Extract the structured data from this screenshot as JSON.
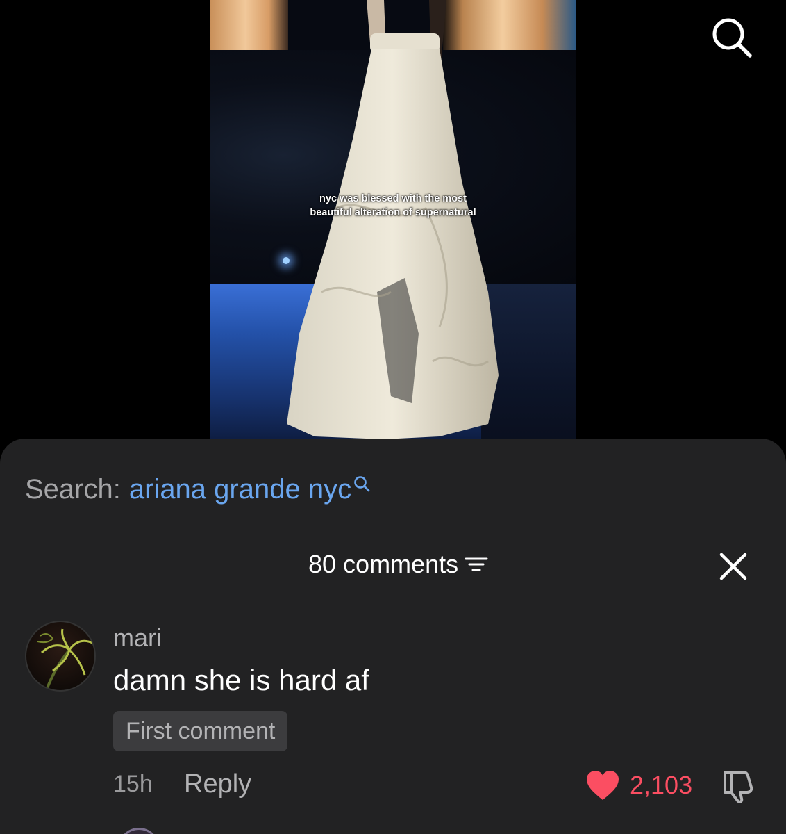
{
  "video": {
    "caption": "nyc was blessed with the most beautiful alteration of supernatural"
  },
  "icons": {
    "top_search": "search-icon",
    "search_term_icon": "search-icon",
    "sort": "sort-icon",
    "close": "close-icon",
    "like": "heart-icon",
    "dislike": "thumbs-down-icon"
  },
  "sheet": {
    "search_prefix": "Search:",
    "search_term": "ariana grande nyc",
    "comments_count": "80 comments",
    "comment": {
      "username": "mari",
      "text": "damn she is hard af",
      "badge": "First comment",
      "time": "15h",
      "reply_label": "Reply",
      "likes": "2,103"
    }
  },
  "colors": {
    "sheet_bg": "#222223",
    "search_link": "#6aa6ef",
    "like_red": "#fb4e62"
  }
}
